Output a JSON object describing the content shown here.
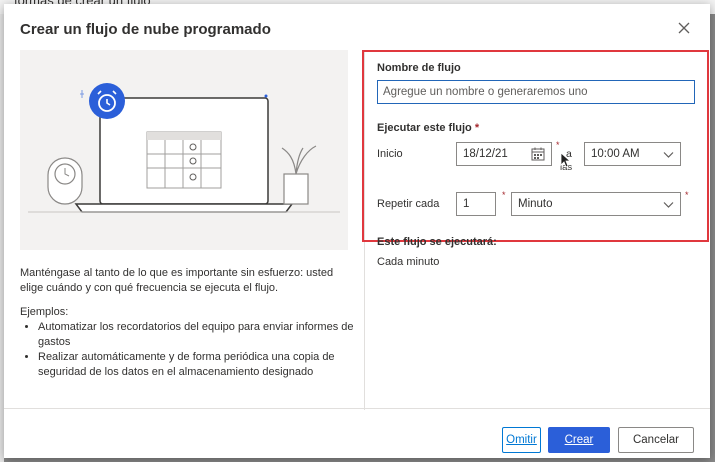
{
  "background": {
    "partial_text": "formas de crear un flujo"
  },
  "dialog": {
    "title": "Crear un flujo de nube programado"
  },
  "left": {
    "description": "Manténgase al tanto de lo que es importante sin esfuerzo: usted elige cuándo y con qué frecuencia se ejecuta el flujo.",
    "examples_title": "Ejemplos:",
    "examples": [
      "Automatizar los recordatorios del equipo para enviar informes de gastos",
      "Realizar automáticamente y de forma periódica una copia de seguridad de los datos en el almacenamiento designado"
    ]
  },
  "form": {
    "flow_name_label": "Nombre de flujo",
    "flow_name_placeholder": "Agregue un nombre o generaremos uno",
    "run_label": "Ejecutar este flujo",
    "required_mark": "*",
    "start_label": "Inicio",
    "start_date": "18/12/21",
    "a_label": "a",
    "las_label": "las",
    "start_time": "10:00 AM",
    "repeat_label": "Repetir cada",
    "repeat_interval": "1",
    "repeat_unit": "Minuto",
    "will_run_label": "Este flujo se ejecutará:",
    "will_run_value": "Cada minuto"
  },
  "footer": {
    "skip_label": "Omitir",
    "create_label": "Crear",
    "cancel_label": "Cancelar"
  },
  "colors": {
    "accent": "#2b5fd9",
    "highlight_border": "#e0383e",
    "input_focus": "#2266b8"
  }
}
